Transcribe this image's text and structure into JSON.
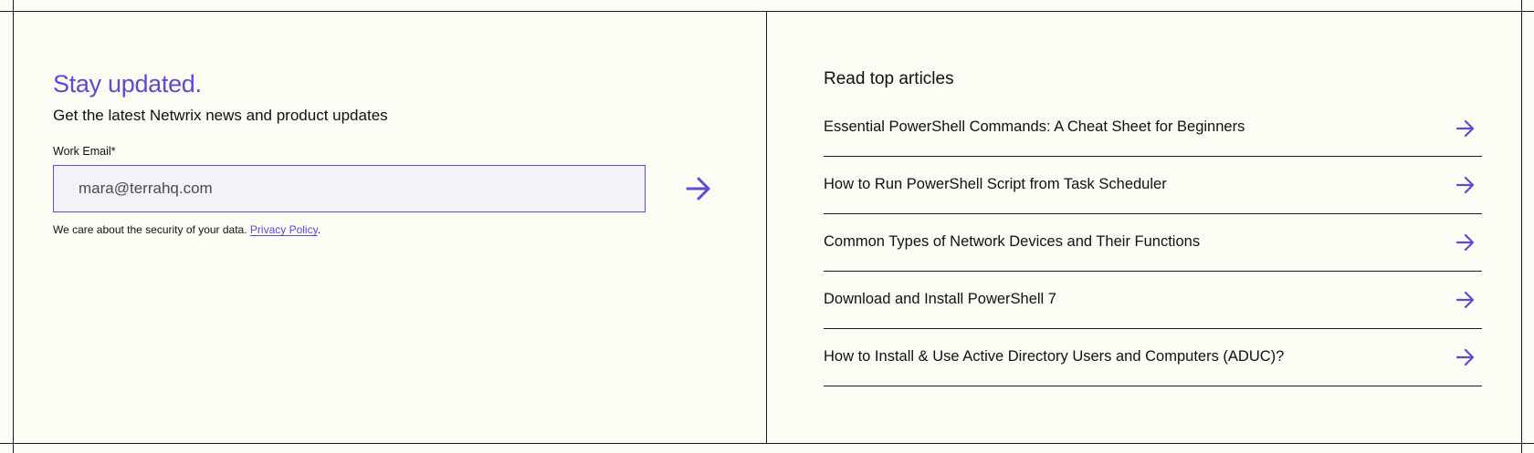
{
  "newsletter": {
    "heading": "Stay updated.",
    "subheading": "Get the latest Netwrix news and product updates",
    "email_label": "Work Email*",
    "email_value": "mara@terrahq.com",
    "privacy_text": "We care about the security of your data.",
    "privacy_link": "Privacy Policy",
    "privacy_period": ".",
    "submit_icon": "arrow-right-icon"
  },
  "articles": {
    "title": "Read top articles",
    "items": [
      {
        "label": "Essential PowerShell Commands: A Cheat Sheet for Beginners"
      },
      {
        "label": "How to Run PowerShell Script from Task Scheduler"
      },
      {
        "label": "Common Types of Network Devices and Their Functions"
      },
      {
        "label": "Download and Install PowerShell 7"
      },
      {
        "label": "How to Install & Use Active Directory Users and Computers (ADUC)?"
      }
    ],
    "item_icon": "arrow-right-icon"
  },
  "colors": {
    "accent": "#5b4bd6",
    "background": "#fcfbf4",
    "input_background": "#f4f2f7",
    "text": "#111111"
  }
}
